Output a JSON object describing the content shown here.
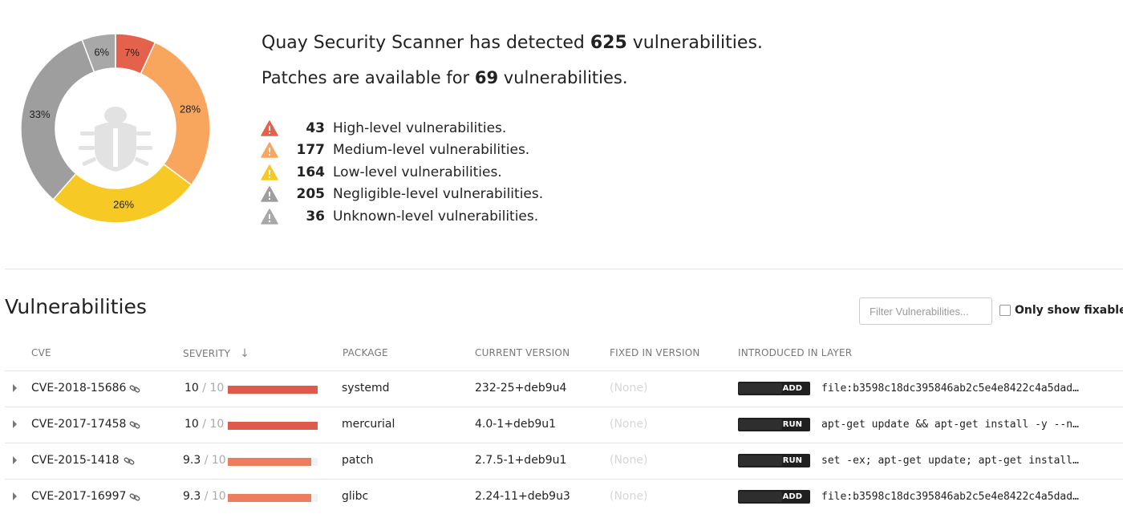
{
  "summary": {
    "headline_prefix": "Quay Security Scanner has detected ",
    "total": "625",
    "headline_suffix": " vulnerabilities.",
    "patch_prefix": "Patches are available for ",
    "patchable": "69",
    "patch_suffix": " vulnerabilities."
  },
  "chart_data": {
    "type": "pie",
    "variant": "donut",
    "center_icon": "bug-icon",
    "slices": [
      {
        "label": "7%",
        "value": 43,
        "color": "#e4624c"
      },
      {
        "label": "28%",
        "value": 177,
        "color": "#f8a55e"
      },
      {
        "label": "26%",
        "value": 164,
        "color": "#f7c925"
      },
      {
        "label": "33%",
        "value": 205,
        "color": "#9e9e9e"
      },
      {
        "label": "6%",
        "value": 36,
        "color": "#a8a8a8"
      }
    ]
  },
  "severity_levels": [
    {
      "count": "43",
      "label": "High-level vulnerabilities.",
      "color": "#e4624c",
      "icon": "warning-icon"
    },
    {
      "count": "177",
      "label": "Medium-level vulnerabilities.",
      "color": "#f8a55e",
      "icon": "warning-icon"
    },
    {
      "count": "164",
      "label": "Low-level vulnerabilities.",
      "color": "#f7c925",
      "icon": "warning-icon"
    },
    {
      "count": "205",
      "label": "Negligible-level vulnerabilities.",
      "color": "#9e9e9e",
      "icon": "warning-icon"
    },
    {
      "count": "36",
      "label": "Unknown-level vulnerabilities.",
      "color": "#a8a8a8",
      "icon": "warning-icon"
    }
  ],
  "vulnerabilities": {
    "title": "Vulnerabilities",
    "filter_placeholder": "Filter Vulnerabilities...",
    "only_fixable_label": "Only show fixable",
    "columns": [
      "CVE",
      "SEVERITY",
      "PACKAGE",
      "CURRENT VERSION",
      "FIXED IN VERSION",
      "INTRODUCED IN LAYER"
    ],
    "sort_icon": "arrow-down-icon",
    "rows": [
      {
        "cve": "CVE-2018-15686",
        "score": "10",
        "max": " / 10",
        "severity_fraction": 1.0,
        "bar_color": "#e05a4c",
        "package": "systemd",
        "current_version": "232-25+deb9u4",
        "fixed_version": "(None)",
        "layer_type": "ADD",
        "layer_cmd": "file:b3598c18dc395846ab2c5e4e8422c4a5dad…"
      },
      {
        "cve": "CVE-2017-17458",
        "score": "10",
        "max": " / 10",
        "severity_fraction": 1.0,
        "bar_color": "#e05a4c",
        "package": "mercurial",
        "current_version": "4.0-1+deb9u1",
        "fixed_version": "(None)",
        "layer_type": "RUN",
        "layer_cmd": "apt-get update && apt-get install -y --n…"
      },
      {
        "cve": "CVE-2015-1418",
        "score": "9.3",
        "max": " / 10",
        "severity_fraction": 0.93,
        "bar_color": "#ec7d5e",
        "package": "patch",
        "current_version": "2.7.5-1+deb9u1",
        "fixed_version": "(None)",
        "layer_type": "RUN",
        "layer_cmd": "set -ex; apt-get update; apt-get install…"
      },
      {
        "cve": "CVE-2017-16997",
        "score": "9.3",
        "max": " / 10",
        "severity_fraction": 0.93,
        "bar_color": "#ec7d5e",
        "package": "glibc",
        "current_version": "2.24-11+deb9u3",
        "fixed_version": "(None)",
        "layer_type": "ADD",
        "layer_cmd": "file:b3598c18dc395846ab2c5e4e8422c4a5dad…"
      }
    ]
  }
}
